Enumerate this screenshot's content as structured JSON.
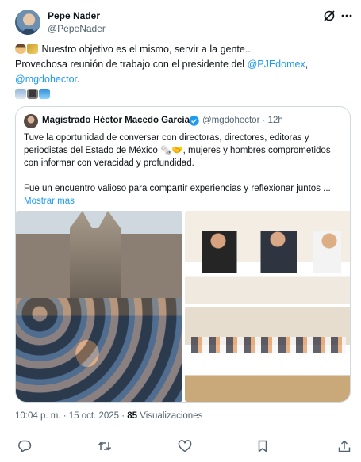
{
  "author": {
    "name": "Pepe Nader",
    "handle": "@PepeNader"
  },
  "tweet": {
    "line1": "Nuestro objetivo es el mismo, servir a la gente...",
    "line2_text": "Provechosa reunión de trabajo con el presidente del ",
    "line2_link": "@PJEdomex",
    "line2_end": ",",
    "line3_link": "@mgdohector",
    "line3_end": "."
  },
  "quote": {
    "name": "Magistrado Héctor Macedo García",
    "handle": "@mgdohector",
    "time": "· 12h",
    "lines": [
      "Tuve la oportunidad de conversar con directoras, directores, editoras y",
      "periodistas del Estado de México 🗞️🤝, mujeres y hombres comprometidos",
      "con informar con veracidad y profundidad.",
      "Fue un encuentro valioso para compartir experiencias y reflexionar juntos ..."
    ],
    "show_more": "Mostrar más"
  },
  "meta": {
    "time": "10:04 p. m. · 15 oct. 2025 · ",
    "views_count": "85",
    "views_label": " Visualizaciones"
  },
  "icons": {
    "reply": "reply-icon",
    "retweet": "retweet-icon",
    "like": "like-icon",
    "bookmark": "bookmark-icon",
    "share": "share-icon",
    "grok": "grok-icon",
    "more": "more-icon",
    "verified": "verified-badge-icon"
  },
  "colors": {
    "link": "#1d9bf0",
    "secondary_text": "#536471",
    "border": "#cfd9de"
  }
}
